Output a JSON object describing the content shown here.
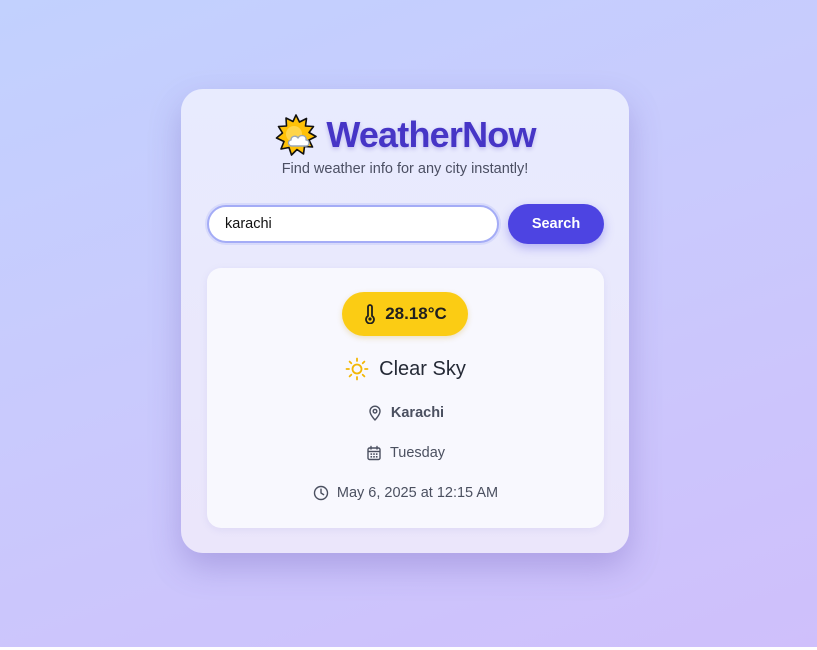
{
  "app": {
    "logo_icon": "sun-behind-cloud-icon",
    "title": "WeatherNow",
    "subtitle": "Find weather info for any city instantly!"
  },
  "search": {
    "value": "karachi",
    "button_label": "Search"
  },
  "result": {
    "temperature": "28.18°C",
    "temperature_icon": "thermometer-icon",
    "condition": "Clear Sky",
    "condition_icon": "sun-icon",
    "location": "Karachi",
    "location_icon": "map-pin-icon",
    "day": "Tuesday",
    "day_icon": "calendar-icon",
    "datetime": "May 6, 2025 at 12:15 AM",
    "datetime_icon": "clock-icon"
  },
  "colors": {
    "accent": "#4d44e2",
    "title": "#4635c6",
    "temperature_badge": "#fbcc14",
    "sun": "#f2b705"
  }
}
